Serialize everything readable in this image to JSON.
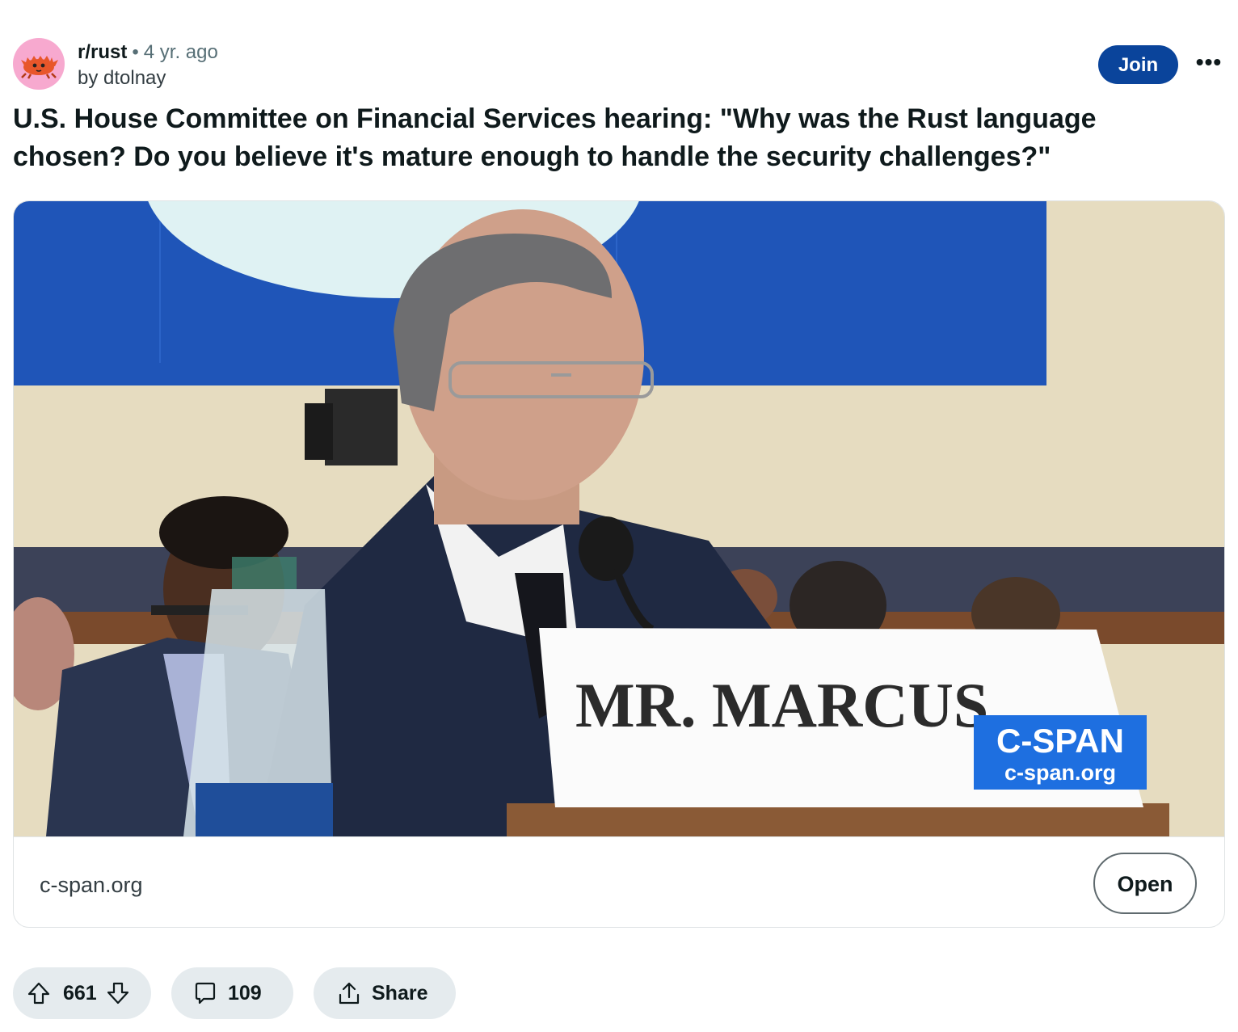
{
  "header": {
    "subreddit": "r/rust",
    "separator": "•",
    "age": "4 yr. ago",
    "author_line": "by dtolnay",
    "join_label": "Join",
    "more_label": "•••"
  },
  "post": {
    "title": "U.S. House Committee on Financial Services hearing: \"Why was the Rust language chosen? Do you believe it's mature enough to handle the security challenges?\""
  },
  "link_card": {
    "image": {
      "nameplate": "MR. MARCUS",
      "watermark_brand": "C-SPAN",
      "watermark_url": "c-span.org"
    },
    "domain": "c-span.org",
    "open_label": "Open"
  },
  "actions": {
    "upvotes": "661",
    "comments": "109",
    "share_label": "Share"
  },
  "colors": {
    "join_button": "#0a449b",
    "pill_background": "#e5ebee",
    "avatar_background": "#f7a9cf",
    "cspan_blue": "#1e6fe0"
  },
  "icons": [
    "ferris-crab-icon",
    "more-icon",
    "upvote-icon",
    "downvote-icon",
    "comment-icon",
    "share-icon"
  ]
}
